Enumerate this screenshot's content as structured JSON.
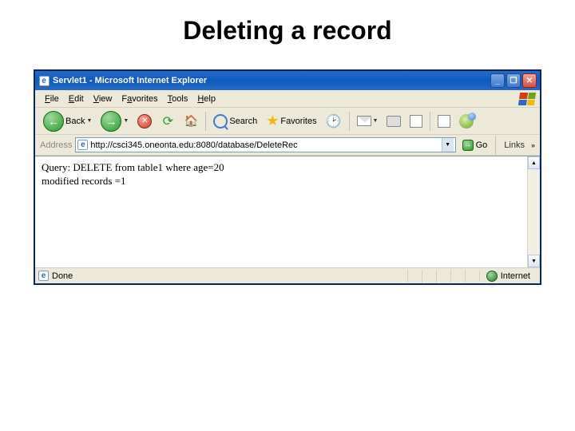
{
  "slide": {
    "title": "Deleting a record"
  },
  "window": {
    "title": "Servlet1 - Microsoft Internet Explorer"
  },
  "menu": {
    "file": "File",
    "edit": "Edit",
    "view": "View",
    "favorites": "Favorites",
    "tools": "Tools",
    "help": "Help"
  },
  "toolbar": {
    "back": "Back",
    "search": "Search",
    "favorites": "Favorites"
  },
  "address": {
    "label": "Address",
    "url": "http://csci345.oneonta.edu:8080/database/DeleteRec",
    "go": "Go",
    "links": "Links"
  },
  "page": {
    "line1": "Query: DELETE from table1 where age=20",
    "line2": "modified records =1"
  },
  "status": {
    "done": "Done",
    "zone": "Internet"
  }
}
